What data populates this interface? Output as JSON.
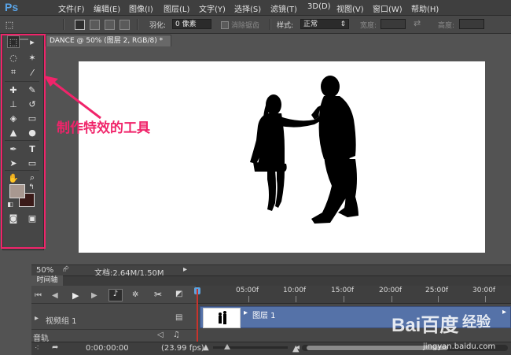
{
  "app": {
    "logo": "Ps"
  },
  "menu": [
    "文件(F)",
    "编辑(E)",
    "图像(I)",
    "图层(L)",
    "文字(Y)",
    "选择(S)",
    "滤镜(T)",
    "3D(D)",
    "视图(V)",
    "窗口(W)",
    "帮助(H)"
  ],
  "options": {
    "feather_label": "羽化:",
    "feather_value": "0 像素",
    "antialias_label": "消除锯齿",
    "style_label": "样式:",
    "style_value": "正常",
    "width_label": "宽度:",
    "height_label": "高度:"
  },
  "document": {
    "tab_title": "DANCE @ 50% (图层 2, RGB/8) *",
    "zoom": "50%",
    "doc_info": "文档:2.64M/1.50M"
  },
  "annotation": {
    "text": "制作特效的工具",
    "color": "#f0246a"
  },
  "timeline": {
    "tab_label": "时间轴",
    "ruler_marks": [
      "05:00f",
      "10:00f",
      "15:00f",
      "20:00f",
      "25:00f",
      "30:00f"
    ],
    "video_group_label": "视频组 1",
    "layer_label": "图层 1",
    "audio_label": "音轨",
    "timecode": "0:00:00:00",
    "fps": "(23.99 fps)"
  },
  "colors": {
    "foreground": "#a89890",
    "background": "#3a1a18",
    "accent": "#5572a8"
  },
  "watermark": {
    "logo": "Bai百度",
    "text": "经验",
    "site": "jingyan.baidu.com"
  }
}
